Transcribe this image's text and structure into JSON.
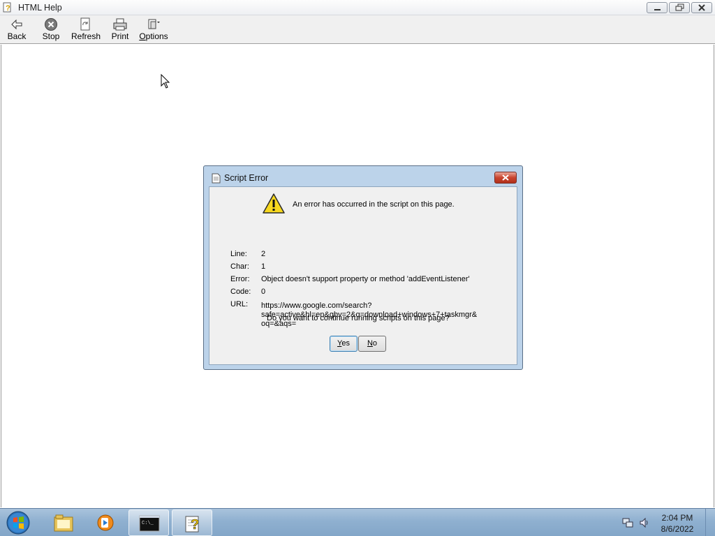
{
  "window": {
    "title": "HTML Help"
  },
  "toolbar": {
    "buttons": [
      {
        "label": "Back",
        "icon": "back-arrow-icon"
      },
      {
        "label": "Stop",
        "icon": "stop-icon"
      },
      {
        "label": "Refresh",
        "icon": "refresh-icon"
      },
      {
        "label": "Print",
        "icon": "printer-icon"
      },
      {
        "label": "Options",
        "icon": "options-icon"
      }
    ]
  },
  "dialog": {
    "title": "Script Error",
    "message": "An error has occurred in the script on this page.",
    "fields": [
      {
        "key": "Line:",
        "value": "2"
      },
      {
        "key": "Char:",
        "value": "1"
      },
      {
        "key": "Error:",
        "value": "Object doesn't support property or method 'addEventListener'"
      },
      {
        "key": "Code:",
        "value": "0"
      },
      {
        "key": "URL:",
        "value": "https://www.google.com/search?\nsafe=active&hl=en&gbv=2&q=download+windows+7+taskmgr&\noq=&aqs="
      }
    ],
    "question": "Do you want to continue running scripts on this page?",
    "yes_label": "Yes",
    "no_label": "No"
  },
  "taskbar": {
    "items": [
      "file-explorer-icon",
      "media-player-icon",
      "command-prompt-icon",
      "html-help-icon"
    ],
    "time": "2:04 PM",
    "date": "8/6/2022"
  },
  "colors": {
    "dialog_frame": "#bcd3ea",
    "taskbar": "#8fb0d0",
    "close_red": "#c9452f",
    "warning_yellow": "#f7d81f"
  }
}
